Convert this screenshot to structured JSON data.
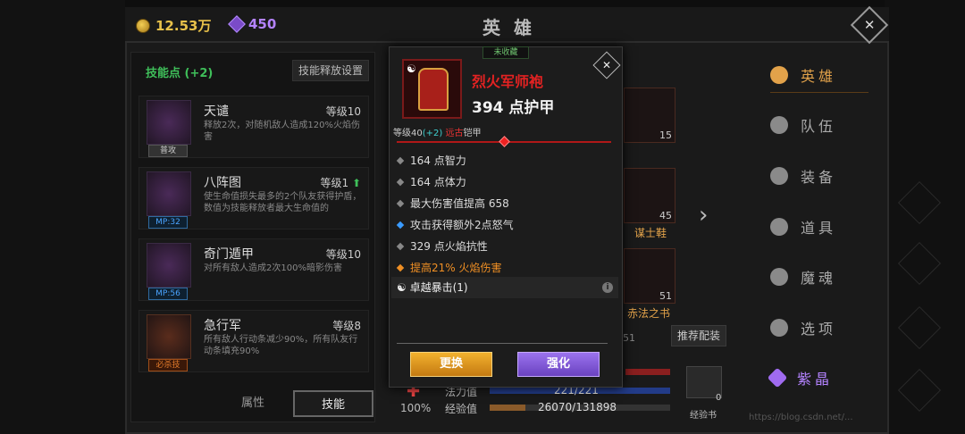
{
  "topbar": {
    "gold": "12.53万",
    "gems": "450",
    "title": "英 雄",
    "close": "✕"
  },
  "skills_panel": {
    "header": "技能点 (+2)",
    "release_settings": "技能释放设置",
    "skills": [
      {
        "name": "天谴",
        "level": "等级10",
        "desc": "释放2次，对随机敌人造成120%火焰伤害",
        "tag": "普攻"
      },
      {
        "name": "八阵图",
        "level": "等级1",
        "desc": "使生命值损失最多的2个队友获得护盾，数值为技能释放者最大生命值的",
        "tag": "MP:32"
      },
      {
        "name": "奇门遁甲",
        "level": "等级10",
        "desc": "对所有敌人造成2次100%暗影伤害",
        "tag": "MP:56"
      },
      {
        "name": "急行军",
        "level": "等级8",
        "desc": "所有敌人行动条减少90%，所有队友行动条填充90%",
        "tag": "必杀技"
      }
    ],
    "tabs": [
      "属性",
      "技能"
    ]
  },
  "hero_area": {
    "slot_counts": [
      "15",
      "45",
      "51"
    ],
    "slot_labels": [
      "谋士鞋",
      "赤法之书"
    ],
    "recommend": "推荐配装",
    "percent": "100%",
    "mana_label": "法力值",
    "mana_value": "221/221",
    "exp_label": "经验值",
    "exp_value": "26070/131898",
    "book_label": "经验书",
    "book_count": "0",
    "partial_count": "51"
  },
  "menu": {
    "items": [
      "英雄",
      "队伍",
      "装备",
      "道具",
      "魔魂",
      "选项",
      "紫晶"
    ]
  },
  "item_popup": {
    "badge": "未收藏",
    "name": "烈火军师袍",
    "armor": "394 点护甲",
    "level_prefix": "等级40",
    "level_bonus": "(+2)",
    "quality": "远古",
    "type": "铠甲",
    "stats": [
      "164 点智力",
      "164 点体力",
      "最大伤害值提高 658",
      "攻击获得额外2点怒气",
      "329 点火焰抗性",
      "提高21% 火焰伤害"
    ],
    "special": "卓越暴击(1)",
    "swap_button": "更换",
    "upgrade_button": "强化"
  },
  "watermark": "https://blog.csdn.net/..."
}
